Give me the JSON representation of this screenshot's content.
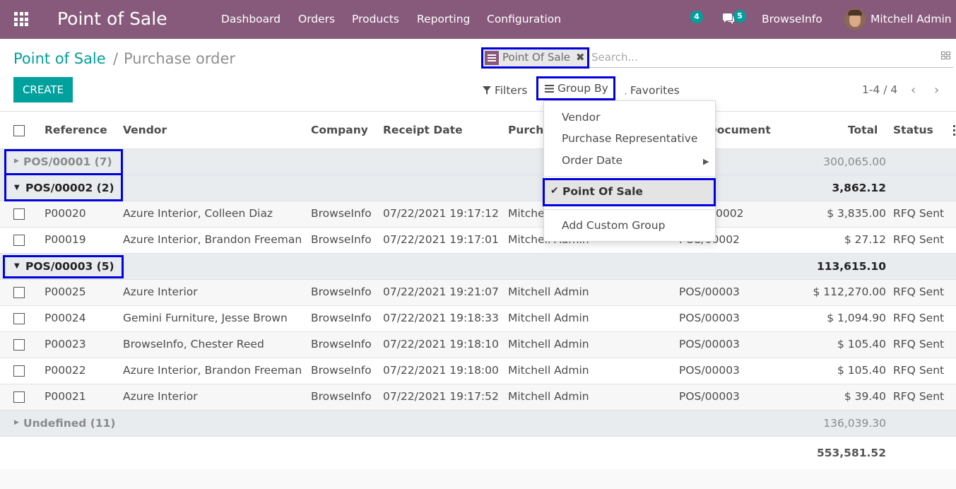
{
  "navbar": {
    "brand": "Point of Sale",
    "menu": [
      "Dashboard",
      "Orders",
      "Products",
      "Reporting",
      "Configuration"
    ],
    "activity_count": "4",
    "messages_count": "5",
    "company": "BrowseInfo",
    "user": "Mitchell Admin"
  },
  "breadcrumb": {
    "parent": "Point of Sale",
    "separator": "/",
    "current": "Purchase order"
  },
  "buttons": {
    "create": "CREATE"
  },
  "search": {
    "facet": "Point Of Sale",
    "facet_close": "✖",
    "placeholder": "Search..."
  },
  "toolbar": {
    "filters": "Filters",
    "group_by": "Group By",
    "favorites": "Favorites",
    "pager": "1-4 / 4",
    "prev": "‹",
    "next": "›"
  },
  "columns": [
    "Reference",
    "Vendor",
    "Company",
    "Receipt Date",
    "Purch",
    "e Document",
    "Total",
    "Status"
  ],
  "groups": [
    {
      "label": "POS/00001 (7)",
      "total": "300,065.00",
      "expanded": false
    },
    {
      "label": "POS/00002 (2)",
      "total": "3,862.12",
      "expanded": true
    },
    {
      "label": "POS/00003 (5)",
      "total": "113,615.10",
      "expanded": true
    },
    {
      "label": "Undefined (11)",
      "total": "136,039.30",
      "expanded": false
    }
  ],
  "rows": [
    {
      "ref": "P00020",
      "vendor": "Azure Interior, Colleen Diaz",
      "company": "BrowseInfo",
      "date": "07/22/2021 19:17:12",
      "rep": "Mitche",
      "source": "0002",
      "total": "$ 3,835.00",
      "status": "RFQ Sent"
    },
    {
      "ref": "P00019",
      "vendor": "Azure Interior, Brandon Freeman",
      "company": "BrowseInfo",
      "date": "07/22/2021 19:17:01",
      "rep": "Mitchell Admin",
      "source": "POS/00002",
      "total": "$ 27.12",
      "status": "RFQ Sent"
    },
    {
      "ref": "P00025",
      "vendor": "Azure Interior",
      "company": "BrowseInfo",
      "date": "07/22/2021 19:21:07",
      "rep": "Mitchell Admin",
      "source": "POS/00003",
      "total": "$ 112,270.00",
      "status": "RFQ Sent"
    },
    {
      "ref": "P00024",
      "vendor": "Gemini Furniture, Jesse Brown",
      "company": "BrowseInfo",
      "date": "07/22/2021 19:18:33",
      "rep": "Mitchell Admin",
      "source": "POS/00003",
      "total": "$ 1,094.90",
      "status": "RFQ Sent"
    },
    {
      "ref": "P00023",
      "vendor": "BrowseInfo, Chester Reed",
      "company": "BrowseInfo",
      "date": "07/22/2021 19:18:10",
      "rep": "Mitchell Admin",
      "source": "POS/00003",
      "total": "$ 105.40",
      "status": "RFQ Sent"
    },
    {
      "ref": "P00022",
      "vendor": "Azure Interior, Brandon Freeman",
      "company": "BrowseInfo",
      "date": "07/22/2021 19:18:00",
      "rep": "Mitchell Admin",
      "source": "POS/00003",
      "total": "$ 105.40",
      "status": "RFQ Sent"
    },
    {
      "ref": "P00021",
      "vendor": "Azure Interior",
      "company": "BrowseInfo",
      "date": "07/22/2021 19:17:52",
      "rep": "Mitchell Admin",
      "source": "POS/00003",
      "total": "$ 39.40",
      "status": "RFQ Sent"
    }
  ],
  "grand_total": "553,581.52",
  "dropdown": {
    "items": [
      "Vendor",
      "Purchase Representative",
      "Order Date"
    ],
    "selected": "Point Of Sale",
    "custom": "Add Custom Group"
  },
  "colors": {
    "navbar": "#875a7b",
    "accent": "#00a09d",
    "highlight_border": "#0000e0"
  }
}
